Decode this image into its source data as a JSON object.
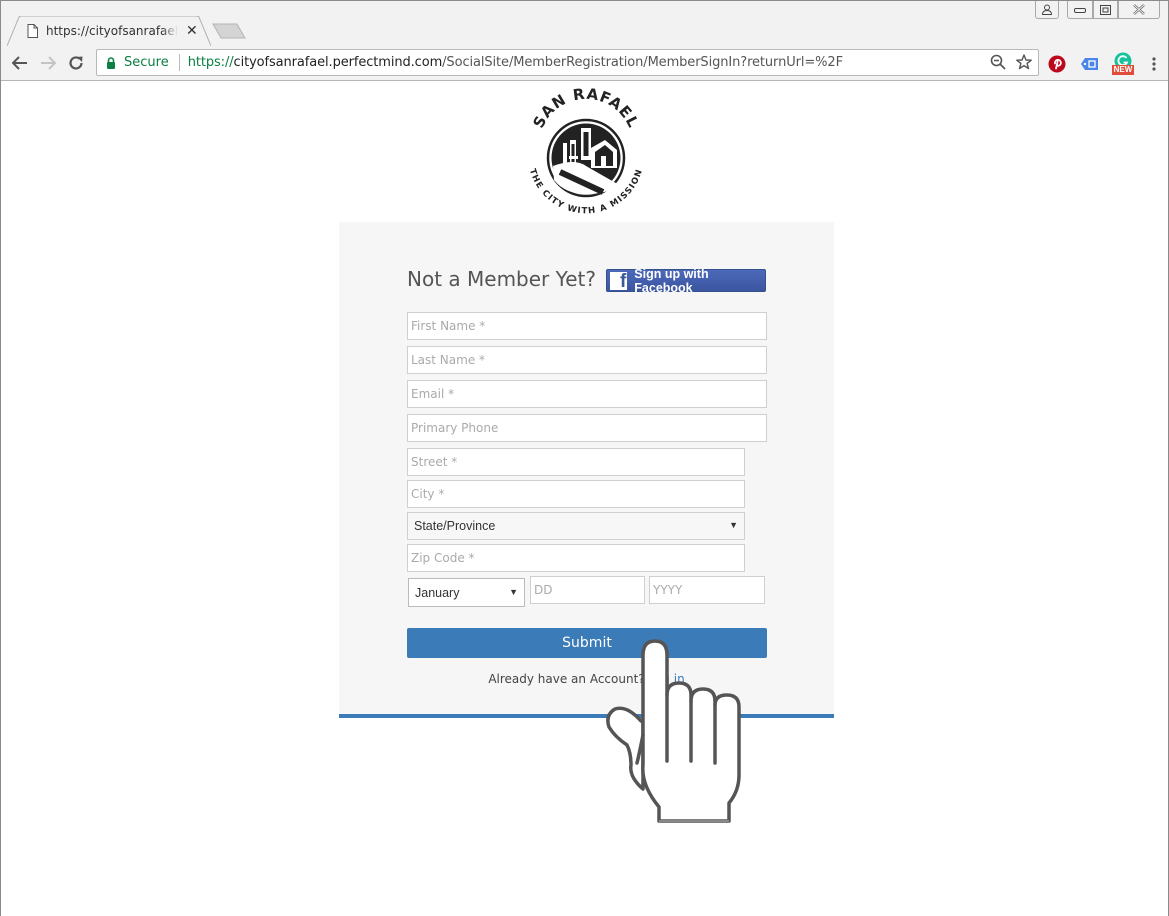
{
  "browser": {
    "tab_title": "https://cityofsanrafael.perfectmind.com",
    "security_label": "Secure",
    "url_scheme": "https://",
    "url_host": "cityofsanrafael.perfectmind.com",
    "url_path": "/SocialSite/MemberRegistration/MemberSignIn?returnUrl=%2F",
    "extension_badge": "NEW",
    "icons": [
      "page-icon",
      "close-icon",
      "back-icon",
      "forward-icon",
      "reload-icon",
      "lock-icon",
      "zoom-out-icon",
      "star-icon",
      "pinterest-icon",
      "tag-extension-icon",
      "grammarly-icon",
      "menu-icon",
      "profile-icon",
      "minimize-icon",
      "maximize-icon",
      "window-close-icon"
    ]
  },
  "logo": {
    "top_text": "SAN RAFAEL",
    "bottom_text": "THE CITY WITH A MISSION"
  },
  "form": {
    "title": "Not a Member Yet?",
    "facebook_button": "Sign up with Facebook",
    "fields": {
      "first_name": "First Name *",
      "last_name": "Last Name *",
      "email": "Email *",
      "phone": "Primary Phone",
      "street": "Street *",
      "city": "City *",
      "zip": "Zip Code *",
      "day": "DD",
      "year": "YYYY"
    },
    "state_select": "State/Province",
    "month_select": "January",
    "submit": "Submit",
    "already_text": "Already have an Account?",
    "login_link": "Log in"
  },
  "colors": {
    "accent": "#3b7bb7",
    "facebook": "#3b5998",
    "secure_green": "#0b8043"
  }
}
